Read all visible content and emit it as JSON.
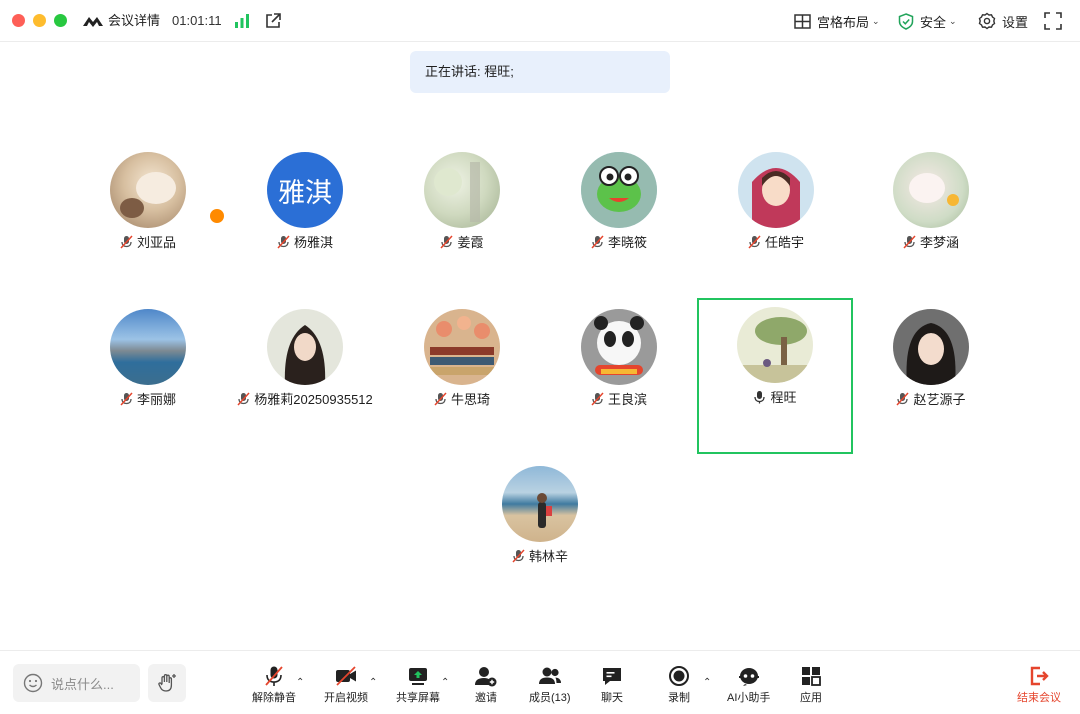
{
  "titlebar": {
    "meeting_title": "会议详情",
    "timer": "01:01:11",
    "layout_label": "宫格布局",
    "security_label": "安全",
    "settings_label": "设置"
  },
  "speaking": {
    "text": "正在讲话: 程旺;"
  },
  "participants": [
    {
      "name": "刘亚品",
      "muted": true,
      "host": true
    },
    {
      "name": "杨雅淇",
      "muted": true,
      "avatar_text": "雅淇"
    },
    {
      "name": "姜霞",
      "muted": true
    },
    {
      "name": "李晓筱",
      "muted": true
    },
    {
      "name": "任皓宇",
      "muted": true
    },
    {
      "name": "李梦涵",
      "muted": true
    },
    {
      "name": "李丽娜",
      "muted": true
    },
    {
      "name": "杨雅莉20250935512",
      "muted": true
    },
    {
      "name": "牛思琦",
      "muted": true
    },
    {
      "name": "王良滨",
      "muted": true
    },
    {
      "name": "程旺",
      "muted": false,
      "speaking": true
    },
    {
      "name": "赵艺源子",
      "muted": true
    },
    {
      "name": "韩林辛",
      "muted": true
    }
  ],
  "toolbar": {
    "chat_placeholder": "说点什么...",
    "unmute_label": "解除静音",
    "video_label": "开启视频",
    "share_label": "共享屏幕",
    "invite_label": "邀请",
    "members_label": "成员(13)",
    "chat_label": "聊天",
    "record_label": "录制",
    "ai_label": "AI小助手",
    "apps_label": "应用",
    "end_label": "结束会议"
  },
  "colors": {
    "active_border": "#21c45f",
    "end_red": "#e5452d",
    "banner_bg": "#e8f0fc",
    "host_badge": "#ff8a00"
  }
}
